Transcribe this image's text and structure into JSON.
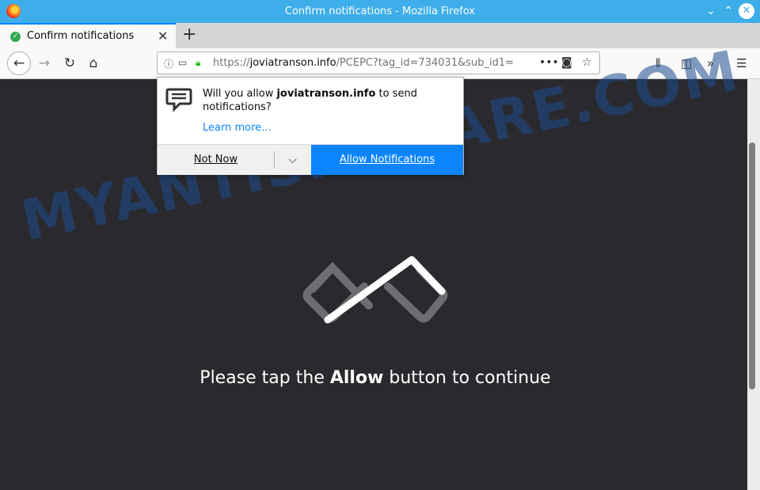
{
  "window": {
    "title": "Confirm notifications - Mozilla Firefox"
  },
  "tab": {
    "label": "Confirm notifications"
  },
  "url": {
    "prefix": "https://",
    "host": "joviatranson.info",
    "path": "/PCEPC?tag_id=734031&sub_id1="
  },
  "popup": {
    "msg_pre": "Will you allow ",
    "msg_site": "joviatranson.info",
    "msg_post": " to send notifications?",
    "learn_more": "Learn more…",
    "not_now": "Not Now",
    "allow": "Allow Notifications"
  },
  "content": {
    "cta_pre": "Please tap the ",
    "cta_bold": "Allow",
    "cta_post": " button to continue"
  },
  "watermark": "MYANTISPYWARE.COM",
  "colors": {
    "accent": "#0a84ff",
    "titlebar": "#3daee9",
    "page_bg": "#2a2a2e"
  }
}
